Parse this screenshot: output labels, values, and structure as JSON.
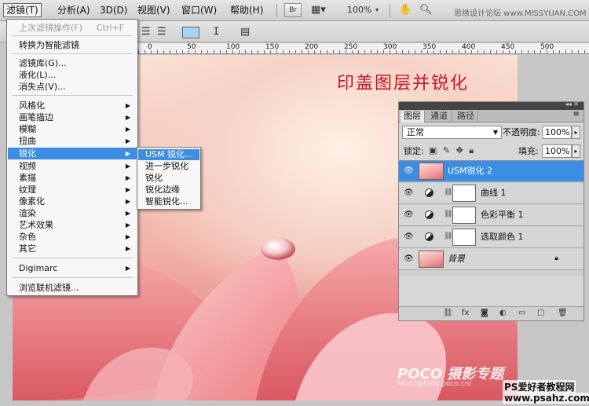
{
  "menubar": {
    "items": [
      "滤镜(T)",
      "分析(A)",
      "3D(D)",
      "视图(V)",
      "窗口(W)",
      "帮助(H)"
    ],
    "br_label": "Br",
    "zoom": "100%",
    "top_watermark": "思缘设计论坛 www.MISSYUAN.COM"
  },
  "filter_menu": {
    "items": [
      {
        "label": "上次滤镜操作(F)",
        "shortcut": "Ctrl+F",
        "disabled": true
      },
      {
        "label": "转换为智能滤镜"
      },
      {
        "label": "滤镜库(G)..."
      },
      {
        "label": "液化(L)..."
      },
      {
        "label": "消失点(V)..."
      },
      {
        "label": "风格化",
        "submenu": true
      },
      {
        "label": "画笔描边",
        "submenu": true
      },
      {
        "label": "模糊",
        "submenu": true
      },
      {
        "label": "扭曲",
        "submenu": true
      },
      {
        "label": "锐化",
        "submenu": true,
        "highlighted": true
      },
      {
        "label": "视频",
        "submenu": true
      },
      {
        "label": "素描",
        "submenu": true
      },
      {
        "label": "纹理",
        "submenu": true
      },
      {
        "label": "像素化",
        "submenu": true
      },
      {
        "label": "渲染",
        "submenu": true
      },
      {
        "label": "艺术效果",
        "submenu": true
      },
      {
        "label": "杂色",
        "submenu": true
      },
      {
        "label": "其它",
        "submenu": true
      },
      {
        "label": "Digimarc",
        "submenu": true
      },
      {
        "label": "浏览联机滤镜..."
      }
    ]
  },
  "sharpen_submenu": {
    "items": [
      "USM 锐化...",
      "进一步锐化",
      "锐化",
      "锐化边缘",
      "智能锐化..."
    ]
  },
  "ruler": {
    "labels": [
      "0",
      "50",
      "100",
      "150",
      "200",
      "250",
      "300",
      "350",
      "400",
      "450",
      "500"
    ]
  },
  "canvas": {
    "title": "印盖图层并锐化",
    "watermark": "POCO 摄影专题",
    "watermark_url": "http://photo.poco.cn/",
    "site_watermark_1": "PS爱好者教程网",
    "site_watermark_2": "www.psahz.com"
  },
  "layers_panel": {
    "tabs": [
      "图层",
      "通道",
      "路径"
    ],
    "blend_mode": "正常",
    "opacity_label": "不透明度:",
    "opacity": "100%",
    "lock_label": "锁定:",
    "fill_label": "填充:",
    "fill": "100%",
    "layers": [
      {
        "name": "USM锐化 2",
        "type": "pixel",
        "selected": true
      },
      {
        "name": "曲线 1",
        "type": "adjustment"
      },
      {
        "name": "色彩平衡 1",
        "type": "adjustment"
      },
      {
        "name": "选取颜色 1",
        "type": "adjustment"
      },
      {
        "name": "背景",
        "type": "background",
        "locked": true
      }
    ]
  },
  "colors": {
    "highlight": "#3b8ee3",
    "title_red": "#c41622",
    "arrow_red": "#d42020"
  }
}
